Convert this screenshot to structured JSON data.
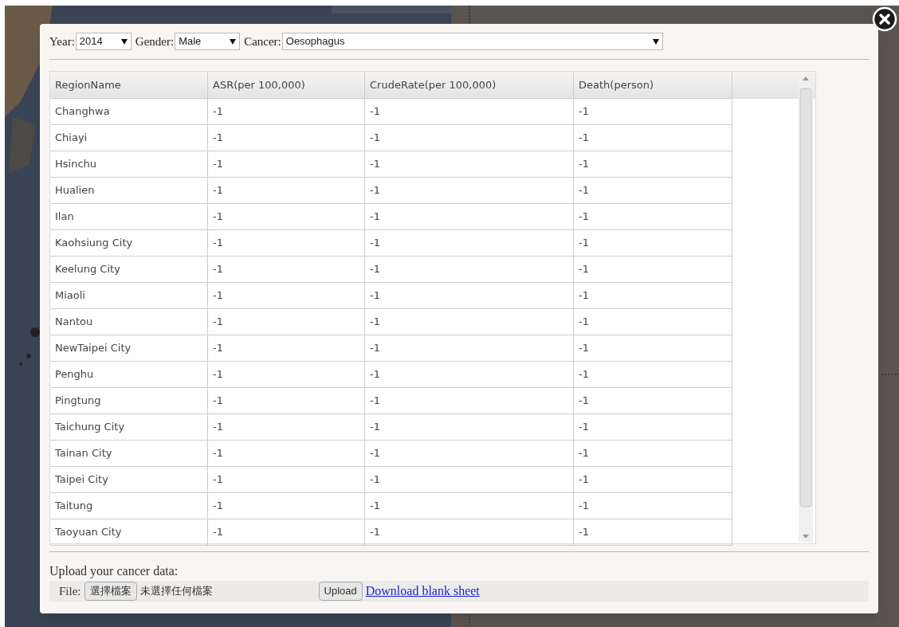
{
  "filters": [
    {
      "label": "Year:",
      "value": "2014"
    },
    {
      "label": "Gender:",
      "value": "Male"
    },
    {
      "label": "Cancer:",
      "value": "Oesophagus"
    }
  ],
  "table": {
    "columns": [
      "RegionName",
      "ASR(per 100,000)",
      "CrudeRate(per 100,000)",
      "Death(person)"
    ],
    "rows": [
      [
        "Changhwa",
        "-1",
        "-1",
        "-1"
      ],
      [
        "Chiayi",
        "-1",
        "-1",
        "-1"
      ],
      [
        "Hsinchu",
        "-1",
        "-1",
        "-1"
      ],
      [
        "Hualien",
        "-1",
        "-1",
        "-1"
      ],
      [
        "Ilan",
        "-1",
        "-1",
        "-1"
      ],
      [
        "Kaohsiung City",
        "-1",
        "-1",
        "-1"
      ],
      [
        "Keelung City",
        "-1",
        "-1",
        "-1"
      ],
      [
        "Miaoli",
        "-1",
        "-1",
        "-1"
      ],
      [
        "Nantou",
        "-1",
        "-1",
        "-1"
      ],
      [
        "NewTaipei City",
        "-1",
        "-1",
        "-1"
      ],
      [
        "Penghu",
        "-1",
        "-1",
        "-1"
      ],
      [
        "Pingtung",
        "-1",
        "-1",
        "-1"
      ],
      [
        "Taichung City",
        "-1",
        "-1",
        "-1"
      ],
      [
        "Tainan City",
        "-1",
        "-1",
        "-1"
      ],
      [
        "Taipei City",
        "-1",
        "-1",
        "-1"
      ],
      [
        "Taitung",
        "-1",
        "-1",
        "-1"
      ],
      [
        "Taoyuan City",
        "-1",
        "-1",
        "-1"
      ]
    ]
  },
  "upload": {
    "heading": "Upload your cancer data:",
    "file_label": "File:",
    "choose_button": "選擇檔案",
    "file_status": "未選擇任何檔案",
    "upload_button": "Upload",
    "download_link": "Download blank sheet"
  }
}
